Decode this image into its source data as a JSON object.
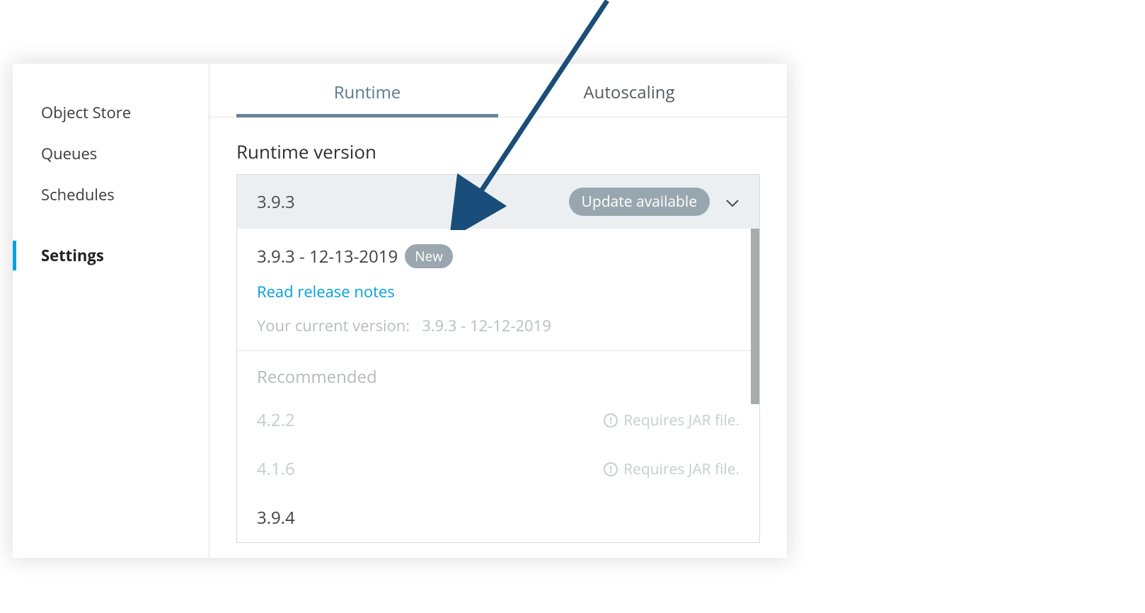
{
  "sidebar": {
    "items": [
      {
        "label": "Object Store"
      },
      {
        "label": "Queues"
      },
      {
        "label": "Schedules"
      },
      {
        "label": "Settings"
      }
    ]
  },
  "tabs": {
    "runtime": "Runtime",
    "autoscaling": "Autoscaling"
  },
  "runtime": {
    "section_title": "Runtime version",
    "selected_version": "3.9.3",
    "update_badge": "Update available",
    "latest_option": "3.9.3 - 12-13-2019",
    "new_badge": "New",
    "release_notes": "Read release notes",
    "current_label": "Your current version:",
    "current_value": "3.9.3 - 12-12-2019",
    "recommended_label": "Recommended",
    "options": [
      {
        "version": "4.2.2",
        "note": "Requires JAR file.",
        "disabled": true
      },
      {
        "version": "4.1.6",
        "note": "Requires JAR file.",
        "disabled": true
      },
      {
        "version": "3.9.4",
        "note": "",
        "disabled": false
      }
    ]
  }
}
